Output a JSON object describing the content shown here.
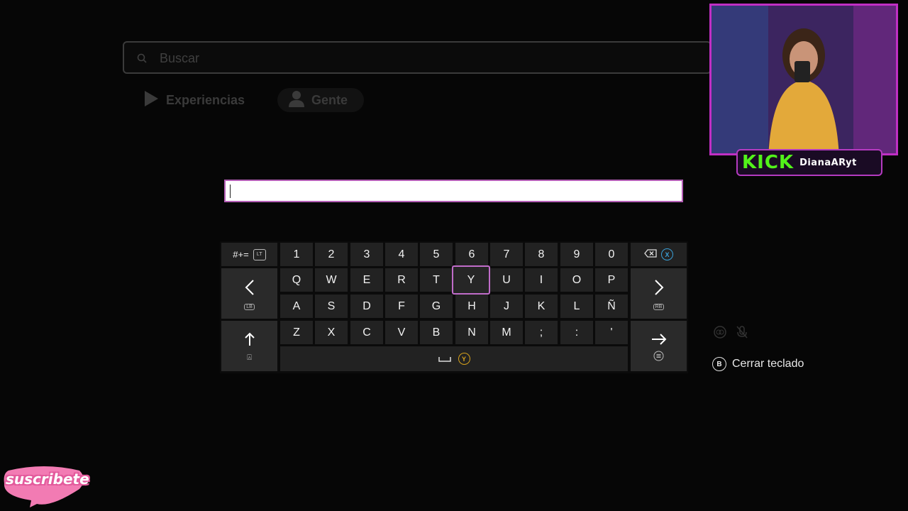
{
  "search": {
    "placeholder": "Buscar"
  },
  "filters": {
    "experiences": "Experiencias",
    "people": "Gente"
  },
  "keyboard": {
    "text_value": "",
    "symbols_key": "#+=",
    "symbols_badge": "LT",
    "backspace_badge": "X",
    "left_badge": "LB",
    "right_badge": "RB",
    "shift_badge": "↑",
    "space_badge": "Y",
    "number_row": [
      "1",
      "2",
      "3",
      "4",
      "5",
      "6",
      "7",
      "8",
      "9",
      "0"
    ],
    "row1": [
      "Q",
      "W",
      "E",
      "R",
      "T",
      "Y",
      "U",
      "I",
      "O",
      "P"
    ],
    "row2": [
      "A",
      "S",
      "D",
      "F",
      "G",
      "H",
      "J",
      "K",
      "L",
      "Ñ"
    ],
    "row3": [
      "Z",
      "X",
      "C",
      "V",
      "B",
      "N",
      "M",
      ";",
      ":",
      "'"
    ],
    "focused_key": "Y"
  },
  "hints": {
    "close_button_badge": "B",
    "close_label": "Cerrar teclado"
  },
  "stream": {
    "platform": "KICK",
    "handle": "DianaARyt",
    "subscribe": "suscribete"
  },
  "colors": {
    "accent": "#c06cc9",
    "kick_green": "#52f21a",
    "badge_blue": "#3aa0d8",
    "badge_yellow": "#d6a11c"
  }
}
